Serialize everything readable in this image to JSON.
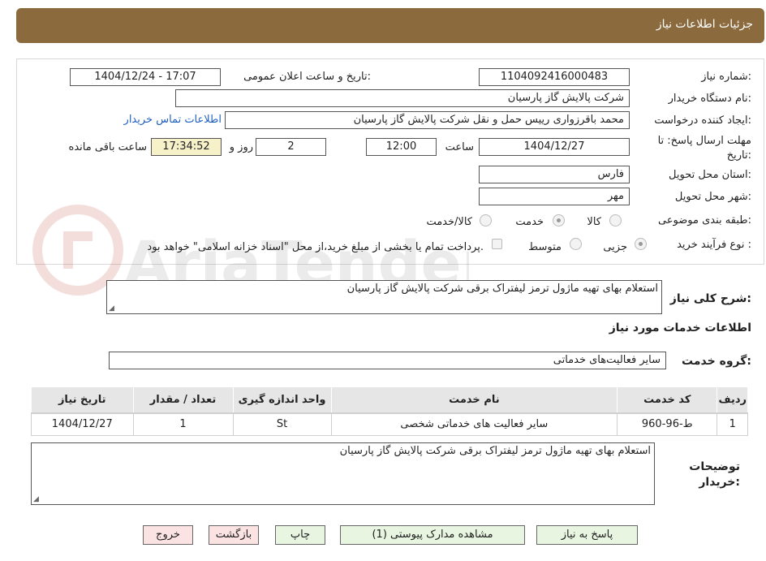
{
  "header": {
    "title": "جزئیات اطلاعات نیاز"
  },
  "form": {
    "need_number": {
      "label": "شماره نیاز:",
      "value": "1104092416000483"
    },
    "announce_datetime": {
      "label": "تاریخ و ساعت اعلان عمومی:",
      "value": "1404/12/24 - 17:07"
    },
    "buyer_org": {
      "label": "نام دستگاه خریدار:",
      "value": "شرکت پالایش گاز پارسیان"
    },
    "requester": {
      "label": "ایجاد کننده درخواست:",
      "value": "محمد باقرزواری رییس حمل و نقل شرکت پالایش گاز پارسیان",
      "contact_link": "اطلاعات تماس خریدار"
    },
    "deadline": {
      "label": "مهلت ارسال پاسخ: تا تاریخ:",
      "date": "1404/12/27",
      "time_label": "ساعت",
      "time": "12:00",
      "days": "2",
      "days_label": "روز و",
      "remaining": "17:34:52",
      "remaining_label": "ساعت باقی مانده"
    },
    "province": {
      "label": "استان محل تحویل:",
      "value": "فارس"
    },
    "city": {
      "label": "شهر محل تحویل:",
      "value": "مهر"
    },
    "category": {
      "label": "طبقه بندی موضوعی:",
      "options": [
        "کالا",
        "خدمت",
        "کالا/خدمت"
      ],
      "selected": "خدمت"
    },
    "purchase_process": {
      "label": "نوع فرآیند خرید :",
      "options": [
        "جزیی",
        "متوسط"
      ],
      "selected": "جزیی",
      "note": "پرداخت تمام یا بخشی از مبلغ خرید،از محل \"اسناد خزانه اسلامی\" خواهد بود."
    }
  },
  "watermark": {
    "text": "AriaTender.neT"
  },
  "summary": {
    "label": "شرح کلی نیاز:",
    "value": "استعلام بهای تهیه ماژول ترمز لیفتراک برقی شرکت پالایش گاز پارسیان"
  },
  "services_section": {
    "title": "اطلاعات خدمات مورد نیاز"
  },
  "service_group": {
    "label": "گروه خدمت:",
    "value": "سایر فعالیت‌های خدماتی"
  },
  "table": {
    "headers": [
      "ردیف",
      "کد خدمت",
      "نام خدمت",
      "واحد اندازه گیری",
      "تعداد / مقدار",
      "تاریخ نیاز"
    ],
    "rows": [
      [
        "1",
        "ط-96-960",
        "سایر فعالیت های خدماتی شخصی",
        "St",
        "1",
        "1404/12/27"
      ]
    ]
  },
  "buyer_notes": {
    "label": "توضیحات خریدار:",
    "value": "استعلام بهای تهیه ماژول ترمز لیفتراک برقی شرکت پالایش گاز پارسیان"
  },
  "buttons": {
    "reply": "پاسخ به نیاز",
    "attachments": "مشاهده مدارک پیوستی (1)",
    "print": "چاپ",
    "back": "بازگشت",
    "exit": "خروج"
  }
}
